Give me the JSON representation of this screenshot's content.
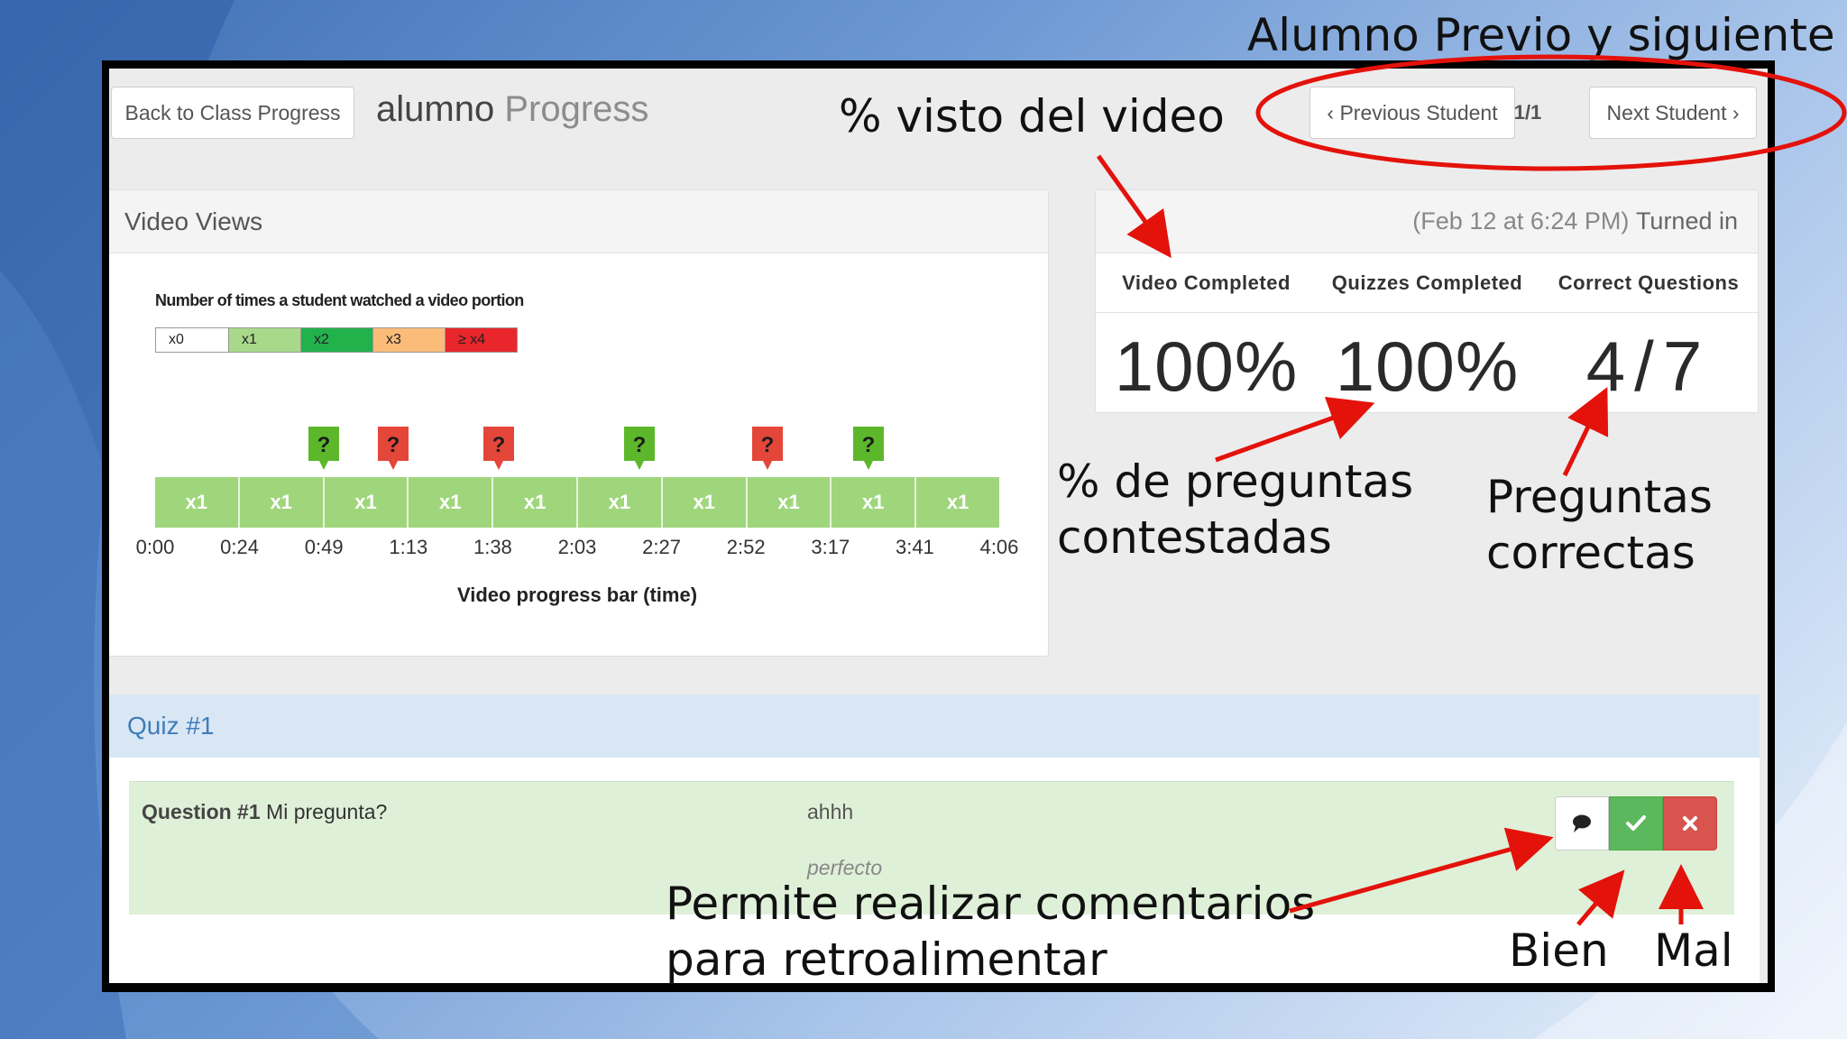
{
  "header": {
    "back_button": "Back to Class Progress",
    "title_name": "alumno",
    "title_suffix": "Progress",
    "prev_button": "‹ Previous Student",
    "pager": "1/1",
    "next_button": "Next Student ›"
  },
  "video_views": {
    "heading": "Video Views",
    "legend_title": "Number of times a student watched a video portion",
    "legend": [
      {
        "label": "x0",
        "color": "#ffffff"
      },
      {
        "label": "x1",
        "color": "#a8d98a"
      },
      {
        "label": "x2",
        "color": "#22b24c"
      },
      {
        "label": "x3",
        "color": "#fcbc79"
      },
      {
        "label": "≥ x4",
        "color": "#e8262b"
      }
    ],
    "segments": [
      "x1",
      "x1",
      "x1",
      "x1",
      "x1",
      "x1",
      "x1",
      "x1",
      "x1",
      "x1"
    ],
    "segment_color": "#9fd67c",
    "quiz_markers": [
      {
        "label": "?",
        "status": "correct",
        "color": "#5cb82a"
      },
      {
        "label": "?",
        "status": "incorrect",
        "color": "#e5463a"
      },
      {
        "label": "?",
        "status": "incorrect",
        "color": "#e5463a"
      },
      {
        "label": "?",
        "status": "correct",
        "color": "#5cb82a"
      },
      {
        "label": "?",
        "status": "incorrect",
        "color": "#e5463a"
      },
      {
        "label": "?",
        "status": "correct",
        "color": "#5cb82a"
      }
    ],
    "ticks": [
      "0:00",
      "0:24",
      "0:49",
      "1:13",
      "1:38",
      "2:03",
      "2:27",
      "2:52",
      "3:17",
      "3:41",
      "4:06"
    ],
    "axis_label": "Video progress bar (time)"
  },
  "summary": {
    "turned_in_date": "(Feb 12 at 6:24 PM)",
    "turned_in_label": "Turned in",
    "columns": [
      {
        "label": "Video Completed",
        "value": "100%"
      },
      {
        "label": "Quizzes Completed",
        "value": "100%"
      },
      {
        "label": "Correct Questions",
        "value": "4/7"
      }
    ]
  },
  "quiz": {
    "heading": "Quiz #1",
    "question": {
      "number": "Question #1",
      "text": "Mi pregunta?",
      "answer": "ahhh",
      "feedback": "perfecto"
    },
    "actions": {
      "comment_color": "#ffffff",
      "correct_color": "#5cb85c",
      "incorrect_color": "#d9534f"
    }
  },
  "annotations": {
    "nav": "Alumno Previo y siguiente",
    "video_pct": "% visto del video",
    "questions_pct_line1": "% de preguntas",
    "questions_pct_line2": "contestadas",
    "correct_line1": "Preguntas",
    "correct_line2": "correctas",
    "comments_line1": "Permite realizar comentarios",
    "comments_line2": "para retroalimentar",
    "bien": "Bien",
    "mal": "Mal",
    "color": "#e3120b"
  }
}
